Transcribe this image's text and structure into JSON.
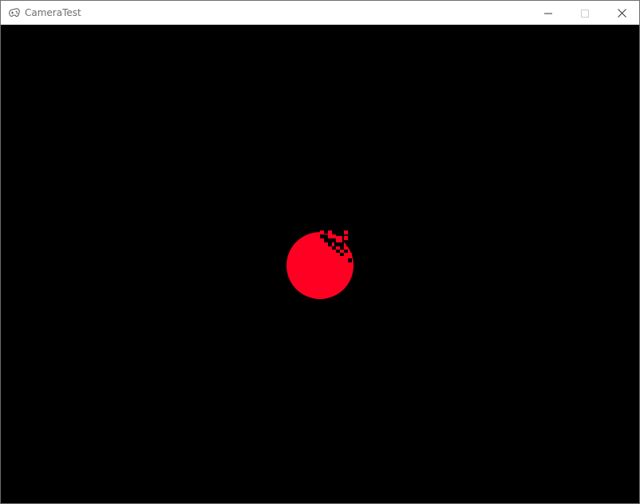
{
  "window": {
    "title": "CameraTest",
    "icon": "gamepad-icon",
    "buttons": {
      "minimize": "minimize-icon",
      "maximize": "maximize-icon",
      "close": "close-icon"
    }
  },
  "scene": {
    "background_color": "#000000",
    "sphere_color": "#ff0022"
  }
}
